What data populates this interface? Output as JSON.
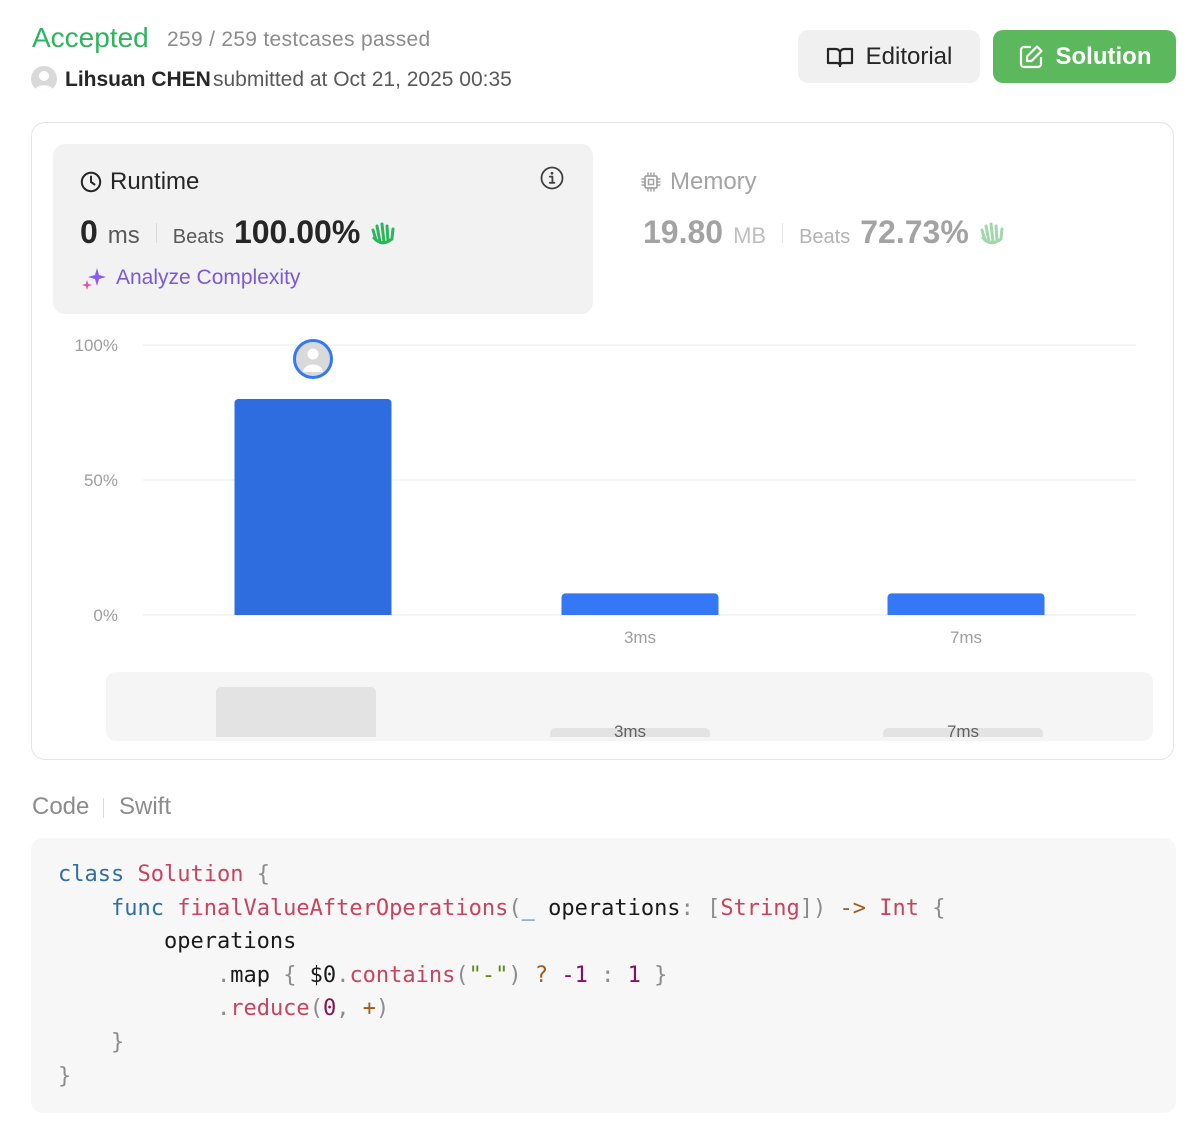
{
  "header": {
    "status": "Accepted",
    "testcases": "259 / 259 testcases passed",
    "author": "Lihsuan CHEN",
    "submitted": "submitted at Oct 21, 2025 00:35",
    "editorial_label": "Editorial",
    "solution_label": "Solution"
  },
  "runtime": {
    "title": "Runtime",
    "value": "0",
    "unit": "ms",
    "beats_label": "Beats",
    "beats_value": "100.00%",
    "analyze_label": "Analyze Complexity"
  },
  "memory": {
    "title": "Memory",
    "value": "19.80",
    "unit": "MB",
    "beats_label": "Beats",
    "beats_value": "72.73%"
  },
  "chart_data": {
    "type": "bar",
    "categories": [
      "",
      "3ms",
      "7ms"
    ],
    "values": [
      80,
      8,
      8
    ],
    "ylim": [
      0,
      100
    ],
    "yticks": [
      "100%",
      "50%",
      "0%"
    ],
    "ytick_values": [
      100,
      50,
      0
    ],
    "highlight_index": 0,
    "grid": true,
    "bar_color": "#3478f6",
    "highlight_color": "#2d6ddf"
  },
  "code": {
    "label": "Code",
    "language": "Swift"
  },
  "colors": {
    "accepted": "#2db55d",
    "solution_button": "#5cb85c",
    "analyze": "#7b58d6"
  },
  "icons": {
    "runtime": "clock-icon",
    "memory": "chip-icon",
    "info": "info-icon",
    "beats": "clapping-hands-icon",
    "editorial": "book-icon",
    "solution": "edit-icon",
    "analyze": "sparkle-icon"
  }
}
